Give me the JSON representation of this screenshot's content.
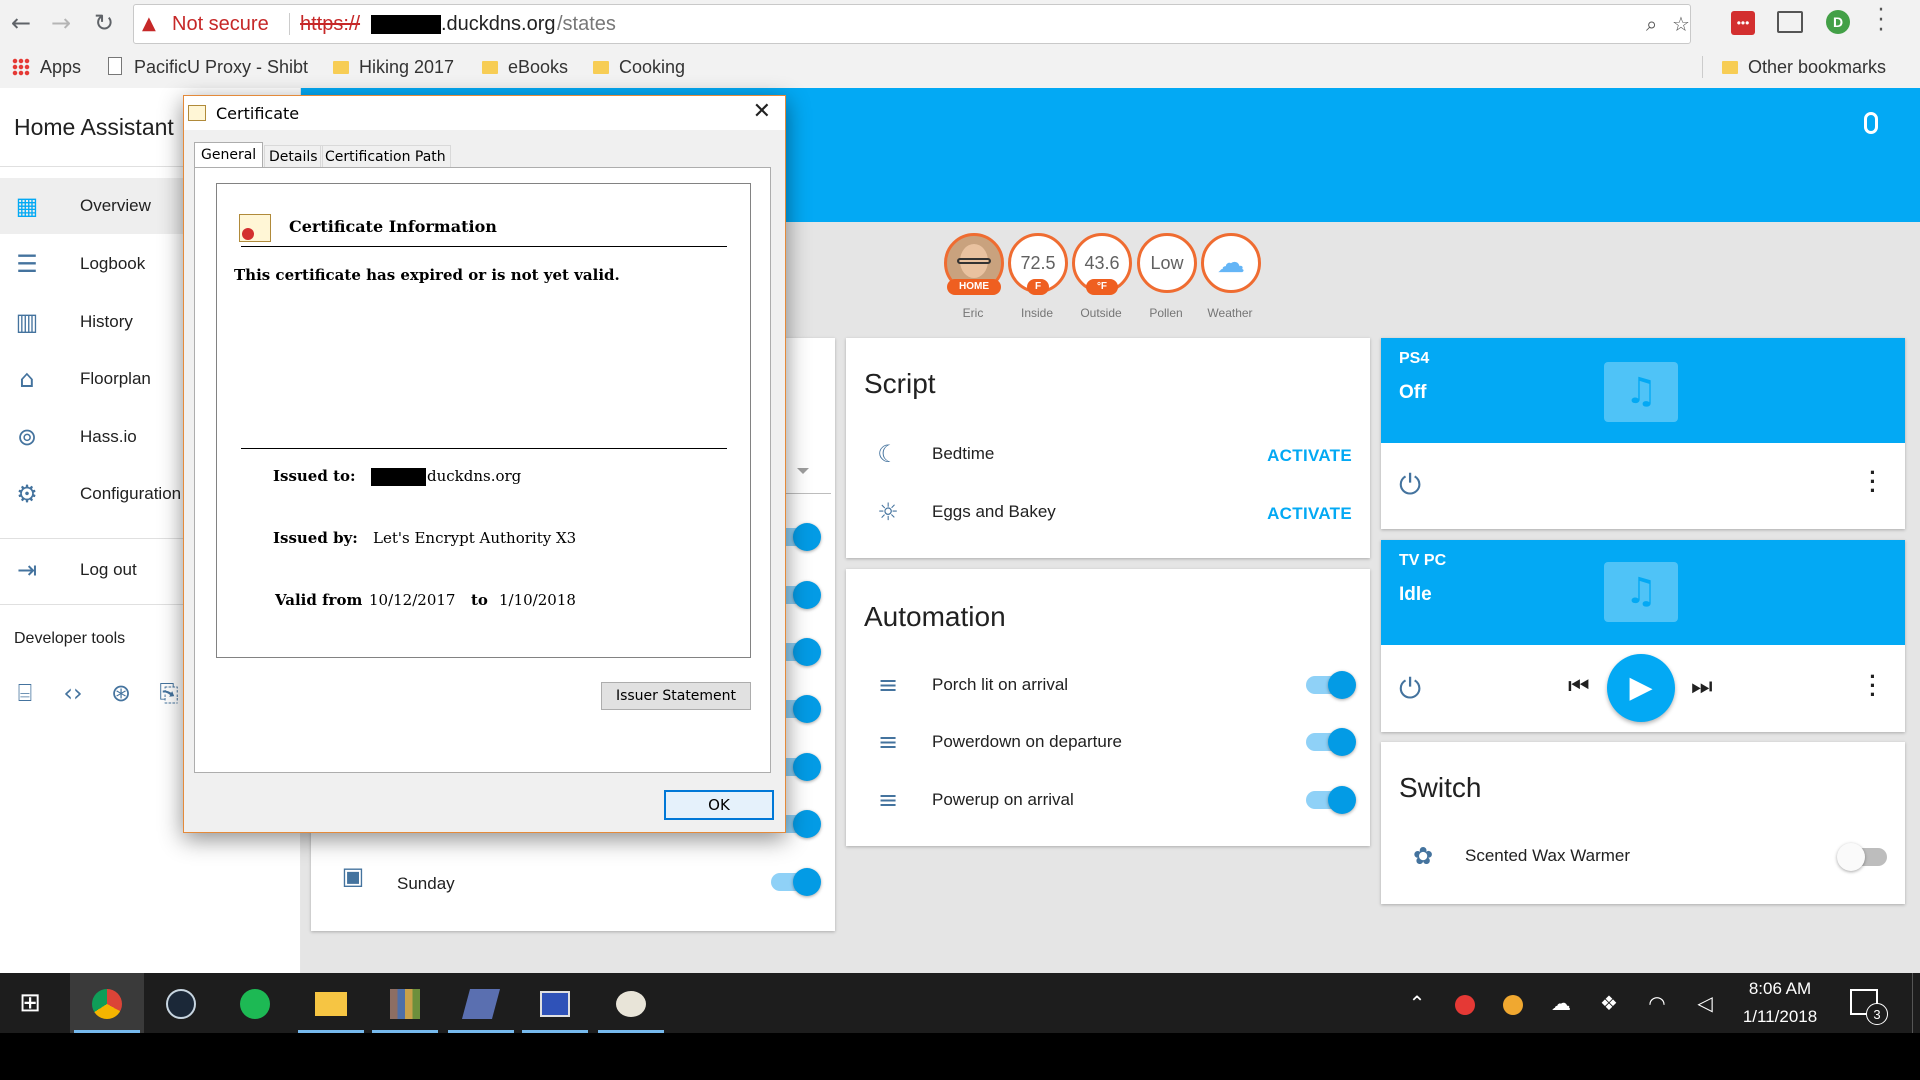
{
  "browser": {
    "security_label": "Not secure",
    "url_scheme": "https://",
    "url_host": ".duckdns.org",
    "url_path": "/states",
    "bookmarks": [
      "Apps",
      "PacificU Proxy - Shibt",
      "Hiking 2017",
      "eBooks",
      "Cooking"
    ],
    "other_bookmarks": "Other bookmarks"
  },
  "app": {
    "title": "Home Assistant"
  },
  "sidebar": {
    "items": [
      {
        "label": "Overview",
        "icon": "grid-icon"
      },
      {
        "label": "Logbook",
        "icon": "list-icon"
      },
      {
        "label": "History",
        "icon": "chart-icon"
      },
      {
        "label": "Floorplan",
        "icon": "home-icon"
      },
      {
        "label": "Hass.io",
        "icon": "hassio-icon"
      },
      {
        "label": "Configuration",
        "icon": "gear-icon"
      },
      {
        "label": "Log out",
        "icon": "logout-icon"
      }
    ],
    "developer_tools_label": "Developer tools"
  },
  "badges": [
    {
      "value": "",
      "tag": "HOME",
      "caption": "Eric"
    },
    {
      "value": "72.5",
      "tag": "F",
      "caption": "Inside"
    },
    {
      "value": "43.6",
      "tag": "°F",
      "caption": "Outside"
    },
    {
      "value": "Low",
      "tag": "",
      "caption": "Pollen"
    },
    {
      "value": "",
      "tag": "",
      "caption": "Weather"
    }
  ],
  "calendar_card": {
    "last_row": "Sunday"
  },
  "script_card": {
    "title": "Script",
    "rows": [
      {
        "label": "Bedtime",
        "action": "ACTIVATE"
      },
      {
        "label": "Eggs and Bakey",
        "action": "ACTIVATE"
      }
    ]
  },
  "automation_card": {
    "title": "Automation",
    "rows": [
      {
        "label": "Porch lit on arrival",
        "on": true
      },
      {
        "label": "Powerdown on departure",
        "on": true
      },
      {
        "label": "Powerup on arrival",
        "on": true
      }
    ]
  },
  "media_players": [
    {
      "name": "PS4",
      "state": "Off"
    },
    {
      "name": "TV PC",
      "state": "Idle"
    }
  ],
  "switch_card": {
    "title": "Switch",
    "rows": [
      {
        "label": "Scented Wax Warmer",
        "on": false
      }
    ]
  },
  "certificate_dialog": {
    "window_title": "Certificate",
    "tabs": [
      "General",
      "Details",
      "Certification Path"
    ],
    "info_heading": "Certificate Information",
    "status_message": "This certificate has expired or is not yet valid.",
    "issued_to_label": "Issued to:",
    "issued_to_value": "duckdns.org",
    "issued_by_label": "Issued by:",
    "issued_by_value": "Let's Encrypt Authority X3",
    "valid_from_label": "Valid from",
    "valid_from_value": "10/12/2017",
    "valid_to_label": "to",
    "valid_to_value": "1/10/2018",
    "issuer_statement_button": "Issuer Statement",
    "ok_button": "OK"
  },
  "taskbar": {
    "time": "8:06 AM",
    "date": "1/11/2018",
    "notification_count": "3"
  },
  "colors": {
    "ha_primary": "#03a9f4",
    "ha_icon": "#44739e",
    "badge_border": "#ef6c31",
    "insecure_red": "#c62828"
  }
}
